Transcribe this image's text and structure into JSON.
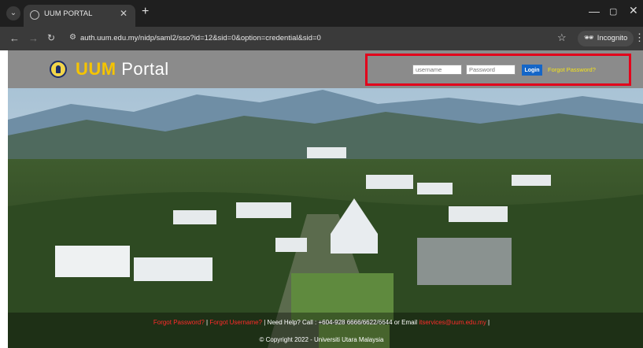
{
  "browser": {
    "tab_title": "UUM PORTAL",
    "new_tab_label": "+",
    "url": "auth.uum.edu.my/nidp/saml2/sso?id=12&sid=0&option=credential&sid=0",
    "incognito_label": "Incognito",
    "icons": [
      "tab-menu-icon",
      "site-icon",
      "close-icon",
      "back-icon",
      "forward-icon",
      "reload-icon",
      "site-info-icon",
      "bookmark-star-icon",
      "incognito-icon",
      "kebab-menu-icon",
      "minimize-icon",
      "maximize-icon"
    ]
  },
  "header": {
    "logo_strong": "UUM",
    "logo_light": " Portal",
    "username_placeholder": "username",
    "password_placeholder": "Password",
    "login_label": "Login",
    "forgot_password": "Forgot Password?"
  },
  "footer": {
    "forgot_password": "Forgot Password?",
    "separator": " | ",
    "forgot_username": "Forgot Username?",
    "help_text": " | Need Help? Call : +604-928 6666/6622/6644 or Email ",
    "email": "itservices@uum.edu.my",
    "trailing": " |",
    "copyright": "© Copyright 2022 - Universiti Utara Malaysia"
  },
  "colors": {
    "highlight_box": "#e3001b",
    "header_bg": "#8b8b8b",
    "login_button": "#1566c8",
    "forgot_link": "#f5e31a",
    "logo_accent": "#f5c400",
    "footer_link": "#ff2a2a"
  }
}
